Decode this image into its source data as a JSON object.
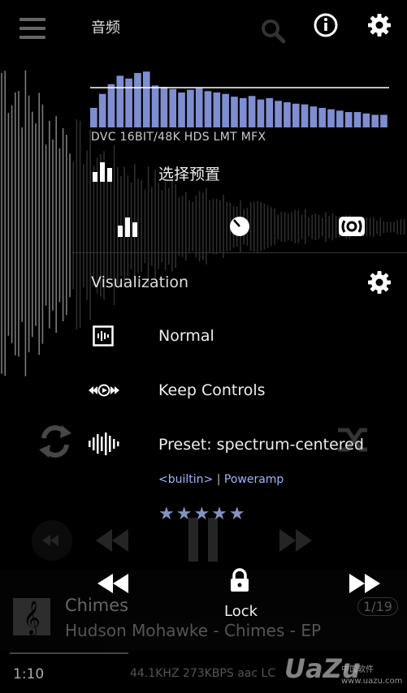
{
  "header": {
    "title": "音频"
  },
  "eq": {
    "format_line": "DVC 16BIT/48K HDS LMT MFX",
    "bar_color": "#7f8ed0",
    "bar_levels": [
      0.28,
      0.48,
      0.62,
      0.74,
      0.7,
      0.78,
      0.8,
      0.6,
      0.58,
      0.55,
      0.5,
      0.54,
      0.56,
      0.52,
      0.5,
      0.48,
      0.44,
      0.42,
      0.45,
      0.4,
      0.42,
      0.38,
      0.36,
      0.34,
      0.33,
      0.3,
      0.28,
      0.26,
      0.24,
      0.22,
      0.22,
      0.2,
      0.18,
      0.18
    ]
  },
  "preset_select_label": "选择预置",
  "visualization": {
    "heading": "Visualization",
    "items": [
      {
        "label": "Normal"
      },
      {
        "label": "Keep Controls"
      },
      {
        "label": "Preset: spectrum-centered"
      }
    ],
    "builtin": "<builtin>",
    "separator": "|",
    "author": "Poweramp",
    "stars": "★★★★★"
  },
  "controls": {
    "lock_label": "Lock"
  },
  "track": {
    "title": "Chimes",
    "artist": "Hudson Mohawke - Chimes - EP",
    "count": "1/19",
    "time": "1:10",
    "meta": "44.1KHZ 273KBPS aac LC"
  },
  "watermark": {
    "main": "UaZu",
    "small": "www.uazu.com",
    "small2": "中国软件"
  }
}
